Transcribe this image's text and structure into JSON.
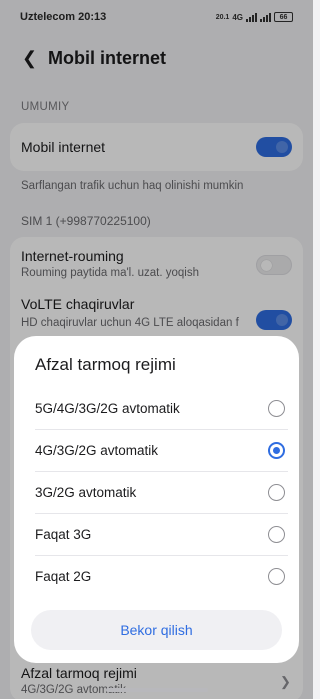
{
  "status_bar": {
    "carrier": "Uztelecom",
    "time": "20:13",
    "net_speed": "20.1",
    "net_type": "4G",
    "battery": "66"
  },
  "header": {
    "title": "Mobil internet"
  },
  "section_general": {
    "label": "UMUMIY"
  },
  "mobile_internet": {
    "label": "Mobil internet",
    "enabled": true,
    "hint": "Sarflangan trafik uchun haq olinishi mumkin"
  },
  "sim1": {
    "label": "SIM 1 (+998770225100)",
    "roaming": {
      "label": "Internet-rouming",
      "sub": "Rouming paytida ma'l. uzat. yoqish",
      "enabled": false
    },
    "volte": {
      "label": "VoLTE chaqiruvlar",
      "sub": "HD chaqiruvlar uchun 4G LTE aloqasidan f",
      "enabled": true
    },
    "network_mode": {
      "label": "Afzal tarmoq rejimi",
      "value": "4G/3G/2G avtomatik"
    }
  },
  "dialog": {
    "title": "Afzal tarmoq rejimi",
    "options": [
      {
        "label": "5G/4G/3G/2G avtomatik",
        "selected": false
      },
      {
        "label": "4G/3G/2G avtomatik",
        "selected": true
      },
      {
        "label": "3G/2G avtomatik",
        "selected": false
      },
      {
        "label": "Faqat 3G",
        "selected": false
      },
      {
        "label": "Faqat 2G",
        "selected": false
      }
    ],
    "cancel_label": "Bekor qilish"
  },
  "colors": {
    "accent": "#2f6de1",
    "background": "#f2f2f4",
    "card": "#ffffff"
  }
}
